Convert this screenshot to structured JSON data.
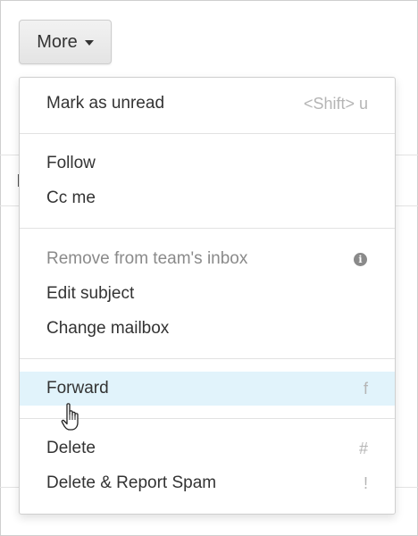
{
  "toolbar": {
    "more_label": "More",
    "caret_icon": "caret-down-icon"
  },
  "menu": {
    "mark_unread": {
      "label": "Mark as unread",
      "shortcut": "<Shift> u"
    },
    "follow": {
      "label": "Follow"
    },
    "cc_me": {
      "label": "Cc me"
    },
    "remove_inbox": {
      "label": "Remove from team's inbox",
      "info_glyph": "i"
    },
    "edit_subject": {
      "label": "Edit subject"
    },
    "change_mailbox": {
      "label": "Change mailbox"
    },
    "forward": {
      "label": "Forward",
      "shortcut": "f"
    },
    "delete": {
      "label": "Delete",
      "shortcut": "#"
    },
    "delete_spam": {
      "label": "Delete & Report Spam",
      "shortcut": "!"
    }
  },
  "colors": {
    "highlight": "#e1f3fb",
    "disabled_text": "#8a8a8a",
    "shortcut_text": "#b5b5b5"
  }
}
